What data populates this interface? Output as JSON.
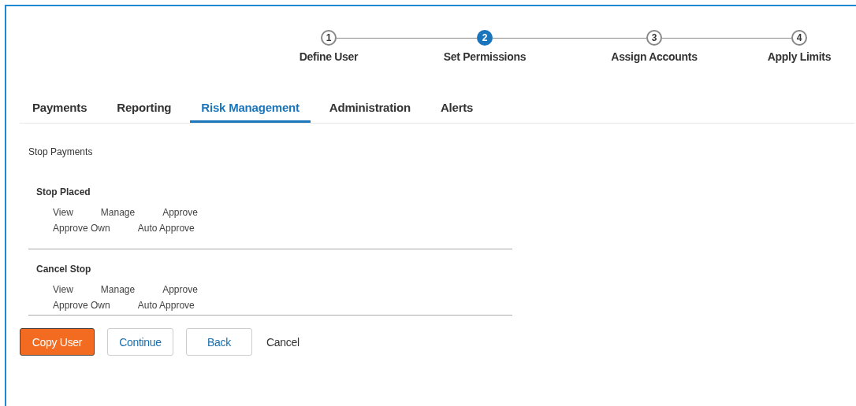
{
  "steps": [
    {
      "number": "1",
      "label": "Define User",
      "selected": false
    },
    {
      "number": "2",
      "label": "Set Permissions",
      "selected": true
    },
    {
      "number": "3",
      "label": "Assign Accounts",
      "selected": false
    },
    {
      "number": "4",
      "label": "Apply Limits",
      "selected": false
    }
  ],
  "tabs": [
    {
      "label": "Payments",
      "selected": false
    },
    {
      "label": "Reporting",
      "selected": false
    },
    {
      "label": "Risk Management",
      "selected": true
    },
    {
      "label": "Administration",
      "selected": false
    },
    {
      "label": "Alerts",
      "selected": false
    }
  ],
  "section_title": "Stop Payments",
  "groups": [
    {
      "title": "Stop Placed",
      "permissions": [
        "View",
        "Manage",
        "Approve",
        "Approve Own",
        "Auto Approve"
      ]
    },
    {
      "title": "Cancel Stop",
      "permissions": [
        "View",
        "Manage",
        "Approve",
        "Approve Own",
        "Auto Approve"
      ]
    }
  ],
  "buttons": [
    {
      "label": "Copy User",
      "kind": "primary"
    },
    {
      "label": "Continue",
      "kind": "secondary"
    },
    {
      "label": "Back",
      "kind": "secondary"
    },
    {
      "label": "Cancel",
      "kind": "link"
    }
  ]
}
